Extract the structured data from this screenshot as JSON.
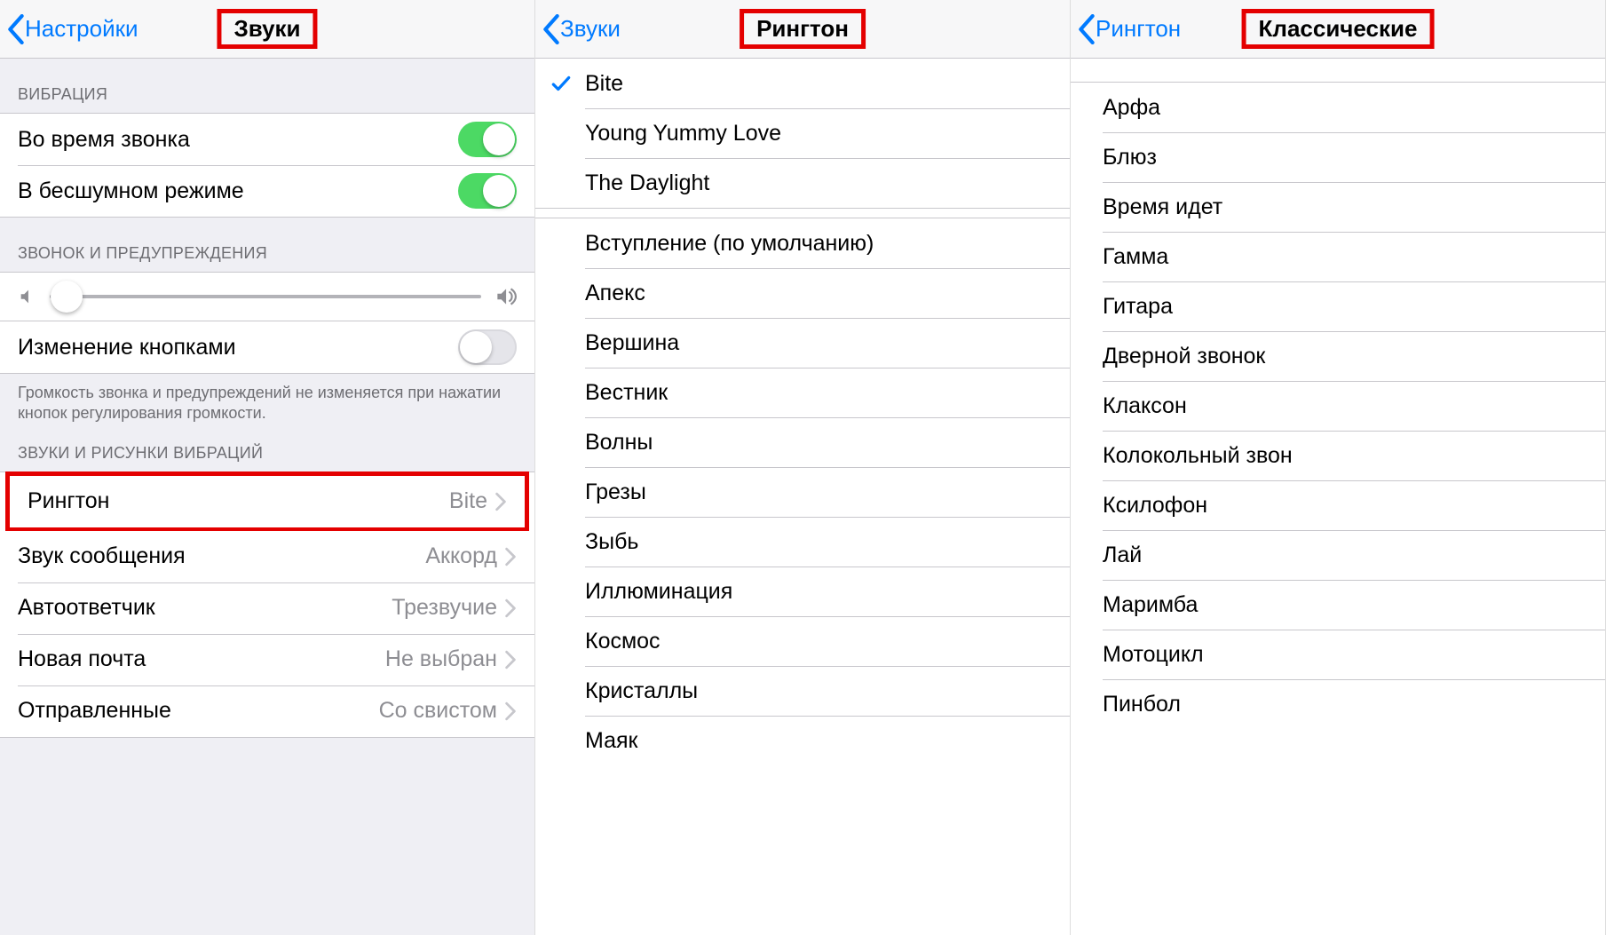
{
  "panel1": {
    "back": "Настройки",
    "title": "Звуки",
    "section_vibration": "ВИБРАЦИЯ",
    "vibrate_on_ring": "Во время звонка",
    "vibrate_on_silent": "В бесшумном режиме",
    "section_rings": "ЗВОНОК И ПРЕДУПРЕЖДЕНИЯ",
    "change_with_buttons": "Изменение кнопками",
    "footer_volume": "Громкость звонка и предупреждений не изменяется при нажатии кнопок регулирования громкости.",
    "section_sounds": "ЗВУКИ И РИСУНКИ ВИБРАЦИЙ",
    "rows": [
      {
        "label": "Рингтон",
        "value": "Bite"
      },
      {
        "label": "Звук сообщения",
        "value": "Аккорд"
      },
      {
        "label": "Автоответчик",
        "value": "Трезвучие"
      },
      {
        "label": "Новая почта",
        "value": "Не выбран"
      },
      {
        "label": "Отправленные",
        "value": "Со свистом"
      }
    ],
    "slider_pos_pct": 4
  },
  "panel2": {
    "back": "Звуки",
    "title": "Рингтон",
    "selected": "Bite",
    "custom": [
      "Bite",
      "Young Yummy Love",
      "The Daylight"
    ],
    "builtin": [
      "Вступление (по умолчанию)",
      "Апекс",
      "Вершина",
      "Вестник",
      "Волны",
      "Грезы",
      "Зыбь",
      "Иллюминация",
      "Космос",
      "Кристаллы",
      "Маяк"
    ]
  },
  "panel3": {
    "back": "Рингтон",
    "title": "Классические",
    "items": [
      "Арфа",
      "Блюз",
      "Время идет",
      "Гамма",
      "Гитара",
      "Дверной звонок",
      "Клаксон",
      "Колокольный звон",
      "Ксилофон",
      "Лай",
      "Маримба",
      "Мотоцикл",
      "Пинбол"
    ]
  }
}
